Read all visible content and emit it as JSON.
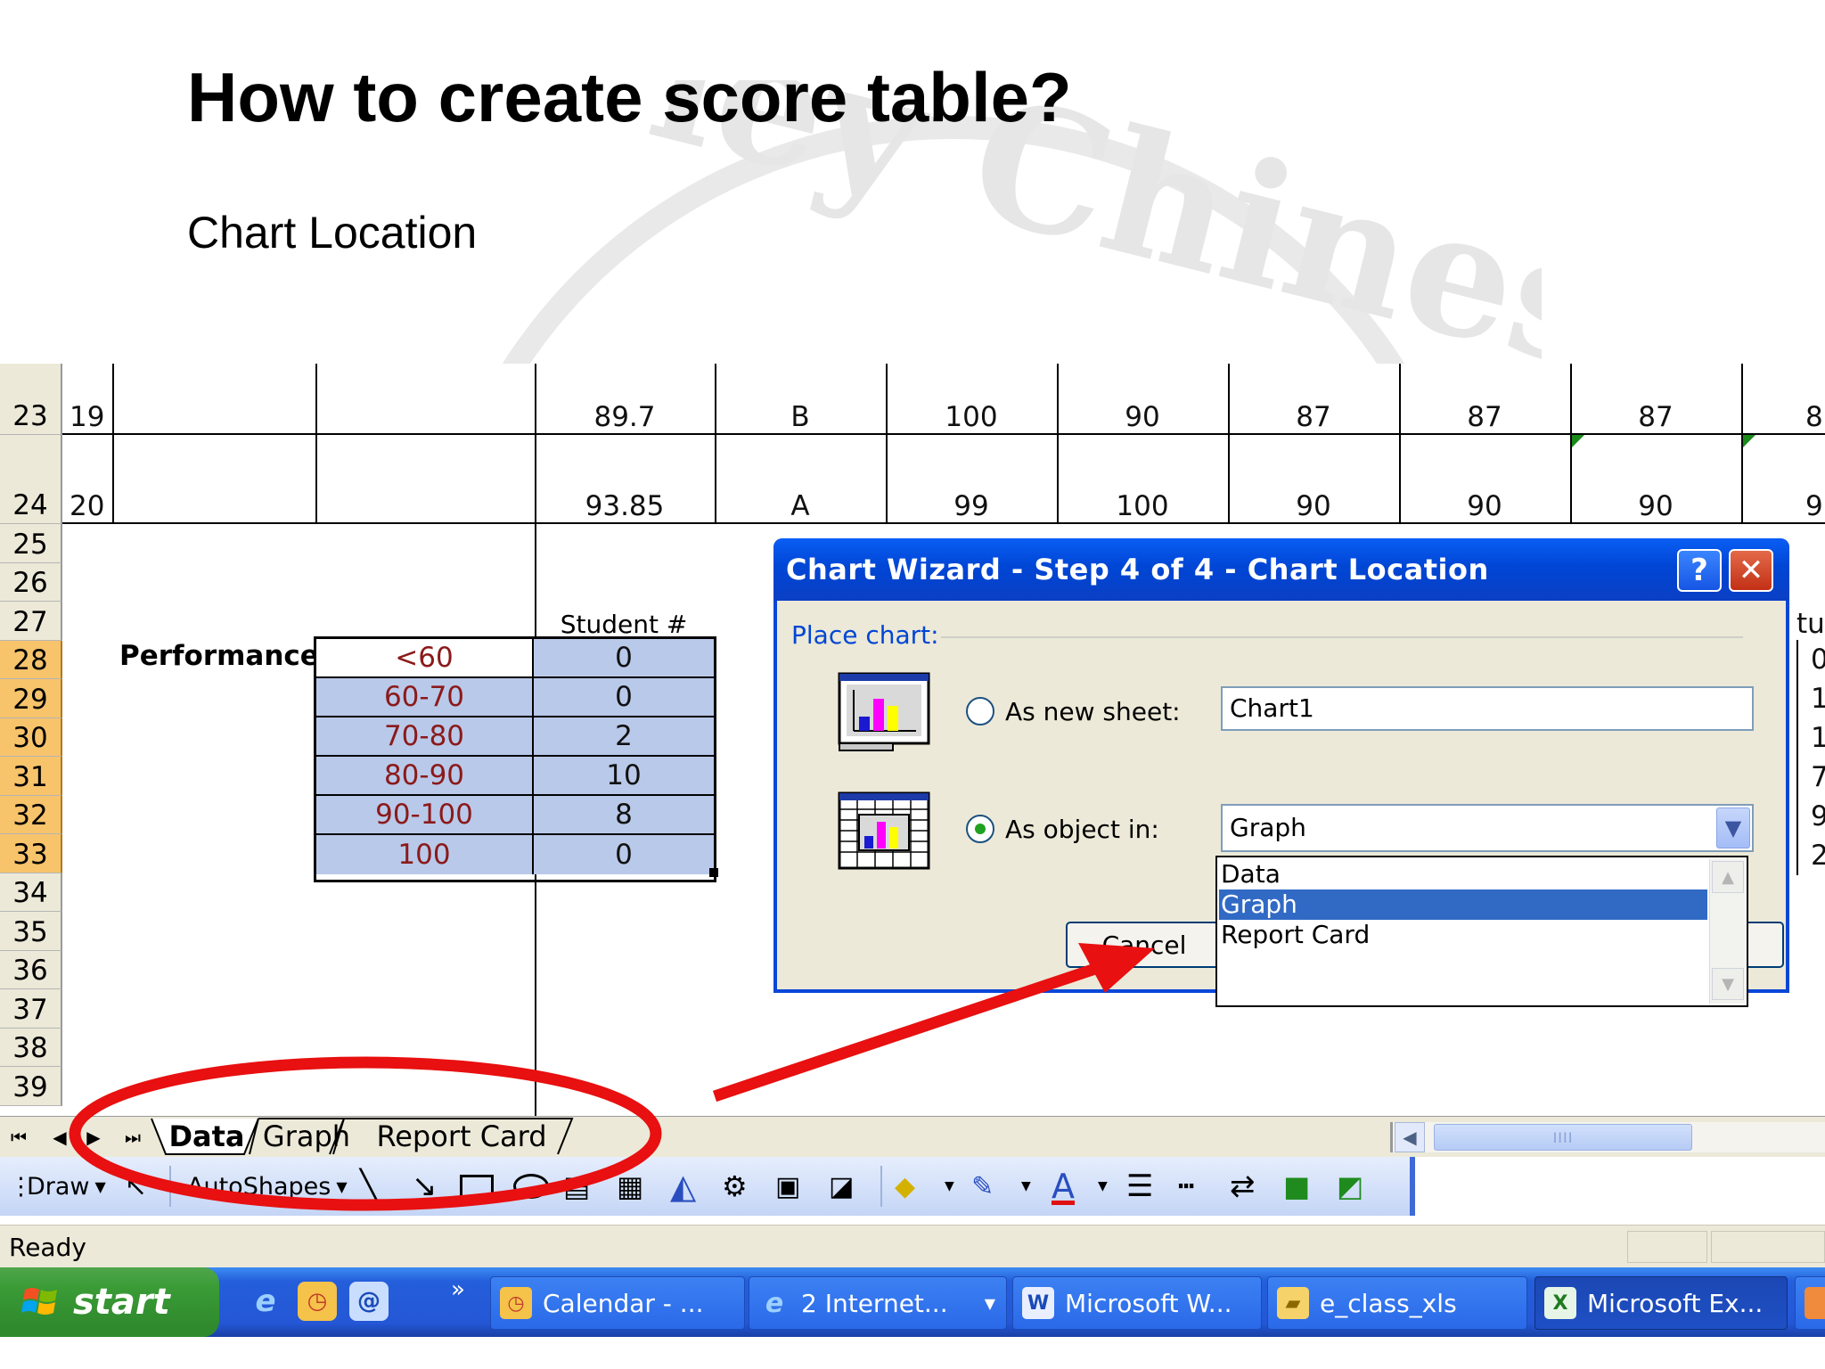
{
  "slide": {
    "title": "How to create score table?",
    "subtitle": "Chart Location"
  },
  "sheet": {
    "rows": [
      {
        "num": "23",
        "c1": "19",
        "c2": "",
        "c3": "",
        "c4": "89.7",
        "c5": "B",
        "c6": "100",
        "c7": "90",
        "c8": "87",
        "c9": "87",
        "c10": "87",
        "c11": "8"
      },
      {
        "num": "24",
        "c1": "20",
        "c2": "",
        "c3": "",
        "c4": "93.85",
        "c5": "A",
        "c6": "99",
        "c7": "100",
        "c8": "90",
        "c9": "90",
        "c10": "90",
        "c11": "9"
      }
    ],
    "row_numbers": [
      "25",
      "26",
      "27",
      "28",
      "29",
      "30",
      "31",
      "32",
      "33",
      "34",
      "35",
      "36",
      "37",
      "38",
      "39"
    ],
    "performance_label": "Performance",
    "student_header": "Student #",
    "score_table": [
      {
        "range": "<60",
        "count": "0"
      },
      {
        "range": "60-70",
        "count": "0"
      },
      {
        "range": "70-80",
        "count": "2"
      },
      {
        "range": "80-90",
        "count": "10"
      },
      {
        "range": "90-100",
        "count": "8"
      },
      {
        "range": "100",
        "count": "0"
      }
    ],
    "right_edge": {
      "header": "tude",
      "values": [
        "0",
        "1",
        "1",
        "7",
        "9",
        "2"
      ]
    }
  },
  "dialog": {
    "title": "Chart Wizard - Step 4 of 4 - Chart Location",
    "help_label": "?",
    "close_label": "✕",
    "group_label": "Place chart:",
    "option_new_sheet": "As new sheet:",
    "option_object_in": "As object in:",
    "new_sheet_value": "Chart1",
    "object_in_value": "Graph",
    "cancel_label": "Cancel",
    "dropdown_items": [
      "Data",
      "Graph",
      "Report Card"
    ],
    "dropdown_selected": "Graph",
    "selected_option": "As object in"
  },
  "tabs": {
    "items": [
      "Data",
      "Graph",
      "Report Card"
    ],
    "active": "Data"
  },
  "drawing_toolbar": {
    "draw_label": "Draw",
    "autoshapes_label": "AutoShapes"
  },
  "status": {
    "text": "Ready"
  },
  "taskbar": {
    "start_label": "start",
    "overflow": "»",
    "buttons": [
      {
        "label": "Calendar - ..."
      },
      {
        "label": "2 Internet..."
      },
      {
        "label": "Microsoft W..."
      },
      {
        "label": "e_class_xls"
      },
      {
        "label": "Microsoft Ex..."
      }
    ]
  },
  "colors": {
    "xp_title_blue": "#0046d5",
    "selection_fill": "#b9c9ea",
    "range_text": "#8b1a1a",
    "annotation_red": "#e81010",
    "row_header_selected": "#f7c36b"
  }
}
